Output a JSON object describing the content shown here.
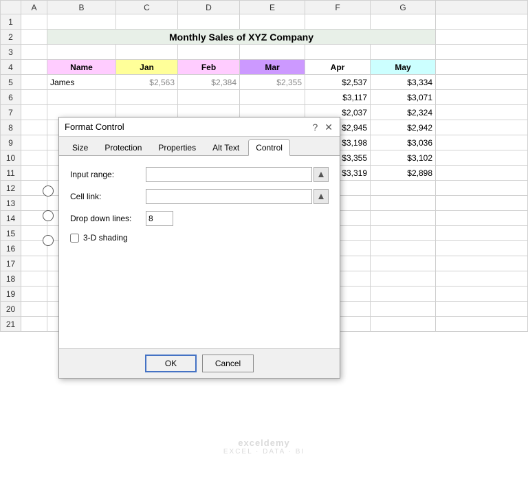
{
  "title": "Monthly Sales of XYZ Company",
  "headers": {
    "row_col": "",
    "col_a": "A",
    "col_b": "B",
    "col_c": "C",
    "col_d": "D",
    "col_e": "E",
    "col_f": "F",
    "col_g": "G",
    "name": "Name",
    "jan": "Jan",
    "feb": "Feb",
    "mar": "Mar",
    "apr": "Apr",
    "may": "May"
  },
  "rows": [
    {
      "row": "5",
      "name": "James",
      "jan": "$2,563",
      "feb": "$2,384",
      "mar": "$2,355",
      "apr": "$2,537",
      "may": "$3,334"
    },
    {
      "row": "6",
      "name": "",
      "jan": "",
      "feb": "",
      "mar": "",
      "apr": "$3,117",
      "may": "$3,071"
    },
    {
      "row": "7",
      "name": "",
      "jan": "",
      "feb": "",
      "mar": "",
      "apr": "$2,037",
      "may": "$2,324"
    },
    {
      "row": "8",
      "name": "",
      "jan": "",
      "feb": "",
      "mar": "",
      "apr": "$2,945",
      "may": "$2,942"
    },
    {
      "row": "9",
      "name": "",
      "jan": "",
      "feb": "",
      "mar": "",
      "apr": "$3,198",
      "may": "$3,036"
    },
    {
      "row": "10",
      "name": "",
      "jan": "",
      "feb": "",
      "mar": "",
      "apr": "$3,355",
      "may": "$3,102"
    },
    {
      "row": "11",
      "name": "",
      "jan": "",
      "feb": "",
      "mar": "",
      "apr": "$3,319",
      "may": "$2,898"
    }
  ],
  "row_numbers": [
    "1",
    "2",
    "3",
    "4",
    "5",
    "6",
    "7",
    "8",
    "9",
    "10",
    "11",
    "12",
    "13",
    "14",
    "15",
    "16",
    "17",
    "18",
    "19",
    "20",
    "21"
  ],
  "dialog": {
    "title": "Format Control",
    "help_icon": "?",
    "close_icon": "✕",
    "tabs": [
      "Size",
      "Protection",
      "Properties",
      "Alt Text",
      "Control"
    ],
    "active_tab": "Control",
    "fields": {
      "input_range_label": "Input range:",
      "input_range_value": "",
      "cell_link_label": "Cell link:",
      "cell_link_value": "",
      "drop_down_lines_label": "Drop down lines:",
      "drop_down_lines_value": "8",
      "shading_label": "3-D shading",
      "shading_checked": false
    },
    "buttons": {
      "ok": "OK",
      "cancel": "Cancel"
    }
  },
  "watermark": {
    "line1": "exceldemy",
    "line2": "EXCEL · DATA · BI"
  }
}
